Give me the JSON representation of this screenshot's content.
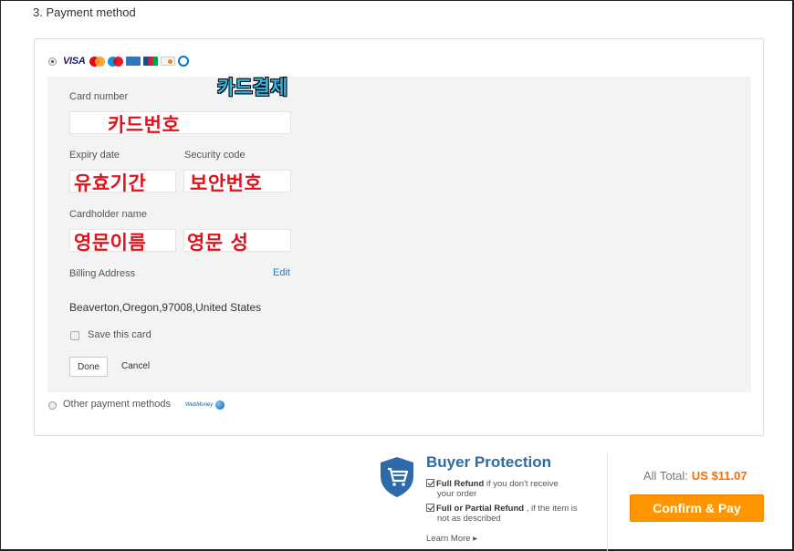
{
  "section": {
    "title": "3. Payment method"
  },
  "payment_option_card": {
    "selected": true,
    "logos": [
      {
        "icon": "visa-logo",
        "text": "VISA"
      },
      {
        "icon": "mastercard-logo"
      },
      {
        "icon": "maestro-logo"
      },
      {
        "icon": "amex-logo"
      },
      {
        "icon": "jcb-logo"
      },
      {
        "icon": "discover-logo"
      },
      {
        "icon": "diners-logo"
      }
    ],
    "annotation": "카드결제"
  },
  "card_form": {
    "card_number": {
      "label": "Card number",
      "annotation": "카드번호"
    },
    "expiry_date": {
      "label": "Expiry date",
      "annotation": "유효기간"
    },
    "security_code": {
      "label": "Security code",
      "annotation": "보안번호"
    },
    "cardholder_name": {
      "label": "Cardholder name",
      "annotation_first": "영문이름",
      "annotation_last": "영문 성"
    },
    "billing": {
      "label": "Billing Address",
      "edit_label": "Edit",
      "address": "Beaverton,Oregon,97008,United States"
    },
    "save_card": {
      "label": "Save this card",
      "checked": false
    },
    "done_label": "Done",
    "cancel_label": "Cancel"
  },
  "other_methods": {
    "label": "Other payment methods",
    "logo_text": "WebMoney",
    "selected": false
  },
  "buyer_protection": {
    "title": "Buyer Protection",
    "items": [
      {
        "bold": "Full Refund",
        "text1": " if you don't receive",
        "text2": "your order"
      },
      {
        "bold": "Full or Partial Refund",
        "text1": " , if the item is",
        "text2": "not as described"
      }
    ],
    "learn_more": "Learn More ▸",
    "shield_color": "#2e6aa8"
  },
  "order": {
    "total_label": "All Total:",
    "total_value": "US $11.07",
    "confirm_label": "Confirm & Pay",
    "accent_color": "#ff9600"
  }
}
